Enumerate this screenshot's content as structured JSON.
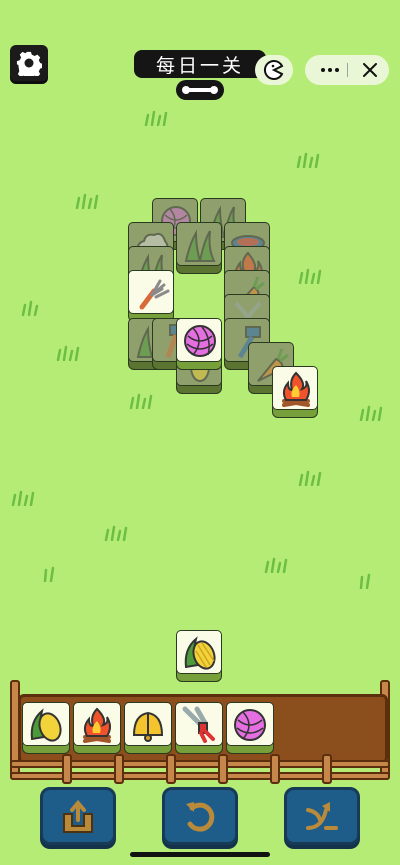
{
  "header": {
    "title": "每日一关",
    "icons": [
      "gear-icon",
      "pacman-icon",
      "more-icon",
      "close-icon",
      "bone-icon"
    ]
  },
  "board": {
    "tiles": [
      {
        "item": "yarn",
        "state": "covered"
      },
      {
        "item": "grass",
        "state": "covered"
      },
      {
        "item": "wool",
        "state": "covered"
      },
      {
        "item": "grass",
        "state": "covered"
      },
      {
        "item": "bowl",
        "state": "covered"
      },
      {
        "item": "grass",
        "state": "covered"
      },
      {
        "item": "fire",
        "state": "covered"
      },
      {
        "item": "pitchfork",
        "state": "free"
      },
      {
        "item": "carrot",
        "state": "covered"
      },
      {
        "item": "scissors",
        "state": "covered"
      },
      {
        "item": "grass",
        "state": "covered"
      },
      {
        "item": "hammer",
        "state": "covered"
      },
      {
        "item": "corn",
        "state": "covered"
      },
      {
        "item": "yarn",
        "state": "free"
      },
      {
        "item": "hammer",
        "state": "covered"
      },
      {
        "item": "carrot",
        "state": "covered"
      },
      {
        "item": "fire",
        "state": "free"
      }
    ],
    "floating": {
      "item": "corn",
      "state": "free"
    }
  },
  "tray": {
    "capacity": 7,
    "slots": [
      "corn",
      "fire",
      "bell",
      "scissors",
      "yarn"
    ]
  },
  "toolbar": {
    "buttons": [
      "move-out-icon",
      "undo-icon",
      "shuffle-icon"
    ]
  },
  "colors": {
    "background": "#b5ec75",
    "tile_face": "#fbfce8",
    "tile_side": "#77a03a",
    "tray": "#8b4e1c",
    "button": "#1e5c8a"
  }
}
